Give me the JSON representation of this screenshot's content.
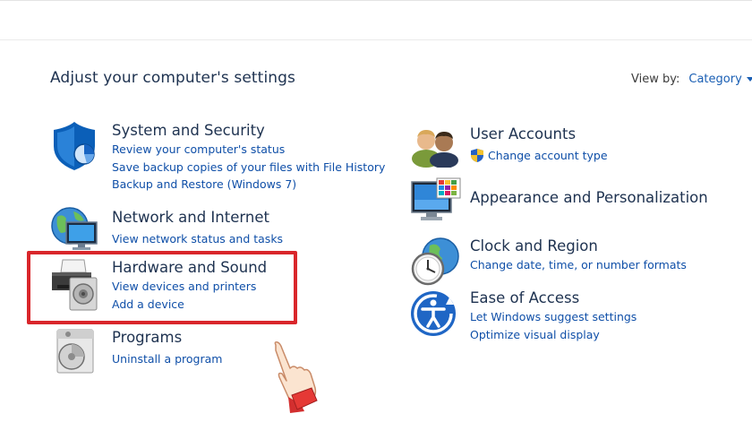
{
  "page": {
    "title": "Adjust your computer's settings",
    "view_by": {
      "label": "View by:",
      "value": "Category"
    }
  },
  "categories_left": [
    {
      "title": "System and Security",
      "links": [
        "Review your computer's status",
        "Save backup copies of your files with File History",
        "Backup and Restore (Windows 7)"
      ],
      "icon": "shield-icon"
    },
    {
      "title": "Network and Internet",
      "links": [
        "View network status and tasks"
      ],
      "icon": "network-globe-icon"
    },
    {
      "title": "Hardware and Sound",
      "links": [
        "View devices and printers",
        "Add a device"
      ],
      "icon": "printer-icon"
    },
    {
      "title": "Programs",
      "links": [
        "Uninstall a program"
      ],
      "icon": "programs-disc-icon"
    }
  ],
  "categories_right": [
    {
      "title": "User Accounts",
      "links": [
        "Change account type"
      ],
      "icon": "users-icon"
    },
    {
      "title": "Appearance and Personalization",
      "links": [],
      "icon": "monitor-palette-icon"
    },
    {
      "title": "Clock and Region",
      "links": [
        "Change date, time, or number formats"
      ],
      "icon": "clock-globe-icon"
    },
    {
      "title": "Ease of Access",
      "links": [
        "Let Windows suggest settings",
        "Optimize visual display"
      ],
      "icon": "ease-of-access-icon"
    }
  ],
  "colors": {
    "highlight": "#d9262b",
    "link": "#0f4fa8",
    "title": "#1e3250"
  }
}
